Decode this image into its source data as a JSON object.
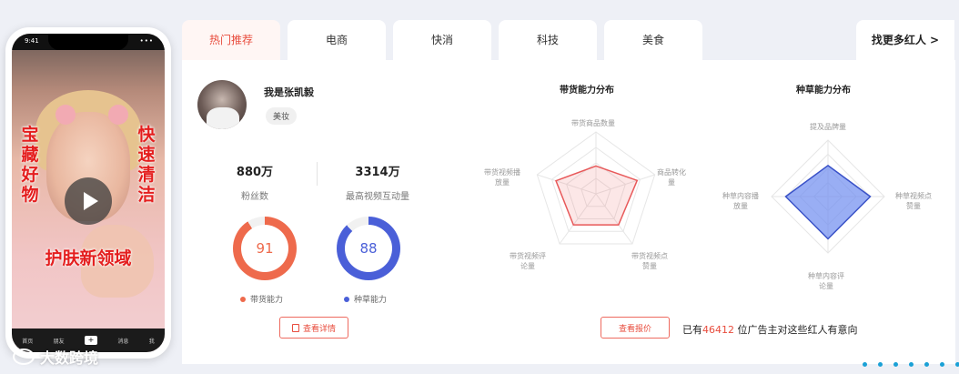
{
  "phone": {
    "time": "9:41",
    "signals": "•••",
    "left_caption": "宝藏好物",
    "right_caption": "快速清洁",
    "big_caption": "护肤新领域",
    "nav": [
      "首页",
      "朋友",
      "+",
      "消息",
      "我"
    ]
  },
  "tabs": [
    {
      "label": "热门推荐",
      "active": true
    },
    {
      "label": "电商",
      "active": false
    },
    {
      "label": "快消",
      "active": false
    },
    {
      "label": "科技",
      "active": false
    },
    {
      "label": "美食",
      "active": false
    }
  ],
  "more_label": "找更多红人 >",
  "profile": {
    "name": "我是张凯毅",
    "tag": "美妆",
    "fans_value": "880万",
    "fans_label": "粉丝数",
    "interaction_value": "3314万",
    "interaction_label": "最高视频互动量",
    "sales_score": "91",
    "sales_label": "带货能力",
    "seed_score": "88",
    "seed_label": "种草能力",
    "details_button": "查看详情",
    "colors": {
      "sales": "#ee6a4c",
      "seed": "#4a5fd8"
    }
  },
  "charts": [
    {
      "title": "带货能力分布",
      "axes": [
        "带货商品数量",
        "商品转化量",
        "带货视频点赞量",
        "带货视频评论量",
        "带货视频播放量"
      ],
      "values": [
        0.45,
        0.7,
        0.62,
        0.62,
        0.68
      ],
      "color": "#e8595a",
      "fill": "rgba(240,120,120,0.18)"
    },
    {
      "title": "种草能力分布",
      "axes": [
        "提及品牌量",
        "种草视频点赞量",
        "种草内容评论量",
        "种草内容播放量"
      ],
      "values": [
        0.55,
        0.75,
        0.75,
        0.75
      ],
      "color": "#3a52c8",
      "fill": "rgba(110,140,240,0.7)"
    }
  ],
  "quote_button": "查看报价",
  "advert": {
    "prefix": "已有",
    "count": "46412",
    "suffix": " 位广告主对这些红人有意向"
  },
  "watermark": "大数跨境"
}
